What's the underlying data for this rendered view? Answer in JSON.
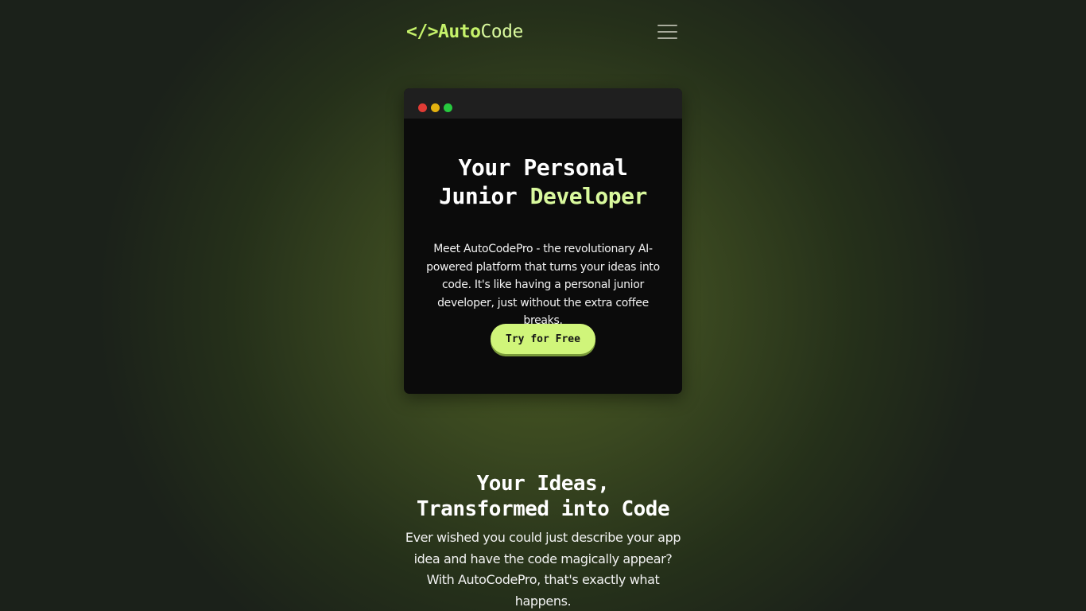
{
  "header": {
    "logo": {
      "brackets": "</>",
      "auto": "Auto",
      "code": "Code"
    },
    "menu_icon": "hamburger-menu-icon"
  },
  "hero": {
    "window_controls": [
      "close-dot",
      "minimize-dot",
      "maximize-dot"
    ],
    "title_line1": "Your Personal",
    "title_line2_plain": "Junior ",
    "title_line2_accent": "Developer",
    "description": "Meet AutoCodePro - the revolutionary AI-powered platform that turns your ideas into code. It's like having a personal junior developer, just without the extra coffee breaks.",
    "cta_label": "Try for Free"
  },
  "section": {
    "title_line1": "Your Ideas,",
    "title_line2": "Transformed into Code",
    "description": "Ever wished you could just describe your app idea and have the code magically appear? With AutoCodePro, that's exactly what happens."
  },
  "colors": {
    "accent": "#d9f99d",
    "button": "#d0f57a",
    "window_bg": "#0b0b0b",
    "titlebar_bg": "#1f1f1f",
    "dot_red": "#e03b35",
    "dot_yellow": "#e3b10f",
    "dot_green": "#27c93f"
  }
}
